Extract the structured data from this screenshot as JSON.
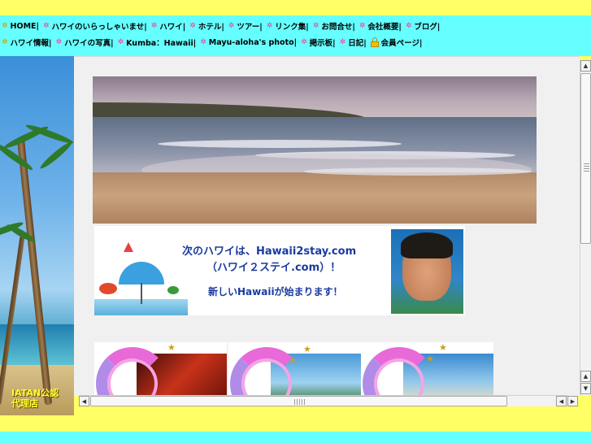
{
  "nav": {
    "row1": [
      {
        "label": "HOME|",
        "bullet": "yellow"
      },
      {
        "label": "ハワイのいらっしゃいませ|",
        "bullet": "pink"
      },
      {
        "label": "ハワイ|",
        "bullet": "pink"
      },
      {
        "label": "ホテル|",
        "bullet": "pink"
      },
      {
        "label": "ツアー|",
        "bullet": "pink"
      },
      {
        "label": "リンク集|",
        "bullet": "pink"
      },
      {
        "label": "お問合せ|",
        "bullet": "pink"
      },
      {
        "label": "会社概要|",
        "bullet": "pink"
      },
      {
        "label": "ブログ|",
        "bullet": "pink"
      }
    ],
    "row2": [
      {
        "label": "ハワイ情報|",
        "bullet": "yellow"
      },
      {
        "label": "ハワイの写真|",
        "bullet": "pink"
      },
      {
        "label": "Kumba：Hawaii|",
        "bullet": "pink"
      },
      {
        "label": "Mayu-aloha's photo|",
        "bullet": "pink"
      },
      {
        "label": "掲示板|",
        "bullet": "pink"
      },
      {
        "label": "日記|",
        "bullet": "pink"
      },
      {
        "label": "会員ページ|",
        "bullet": "lock"
      }
    ]
  },
  "sidebar": {
    "badge_line1": "IATAN公認",
    "badge_line2": "代理店"
  },
  "banner": {
    "line1": "次のハワイは、Hawaii2stay.com",
    "line2": "（ハワイ２ステイ.com）！",
    "line3": "新しいHawaiiが始まります！"
  },
  "scrollbars": {
    "up_arrow": "▲",
    "down_arrow": "▼",
    "left_arrow": "◀",
    "right_arrow": "▶"
  },
  "colors": {
    "frame_yellow": "#ffff66",
    "nav_cyan": "#66ffff",
    "banner_text": "#1a3aa0"
  }
}
